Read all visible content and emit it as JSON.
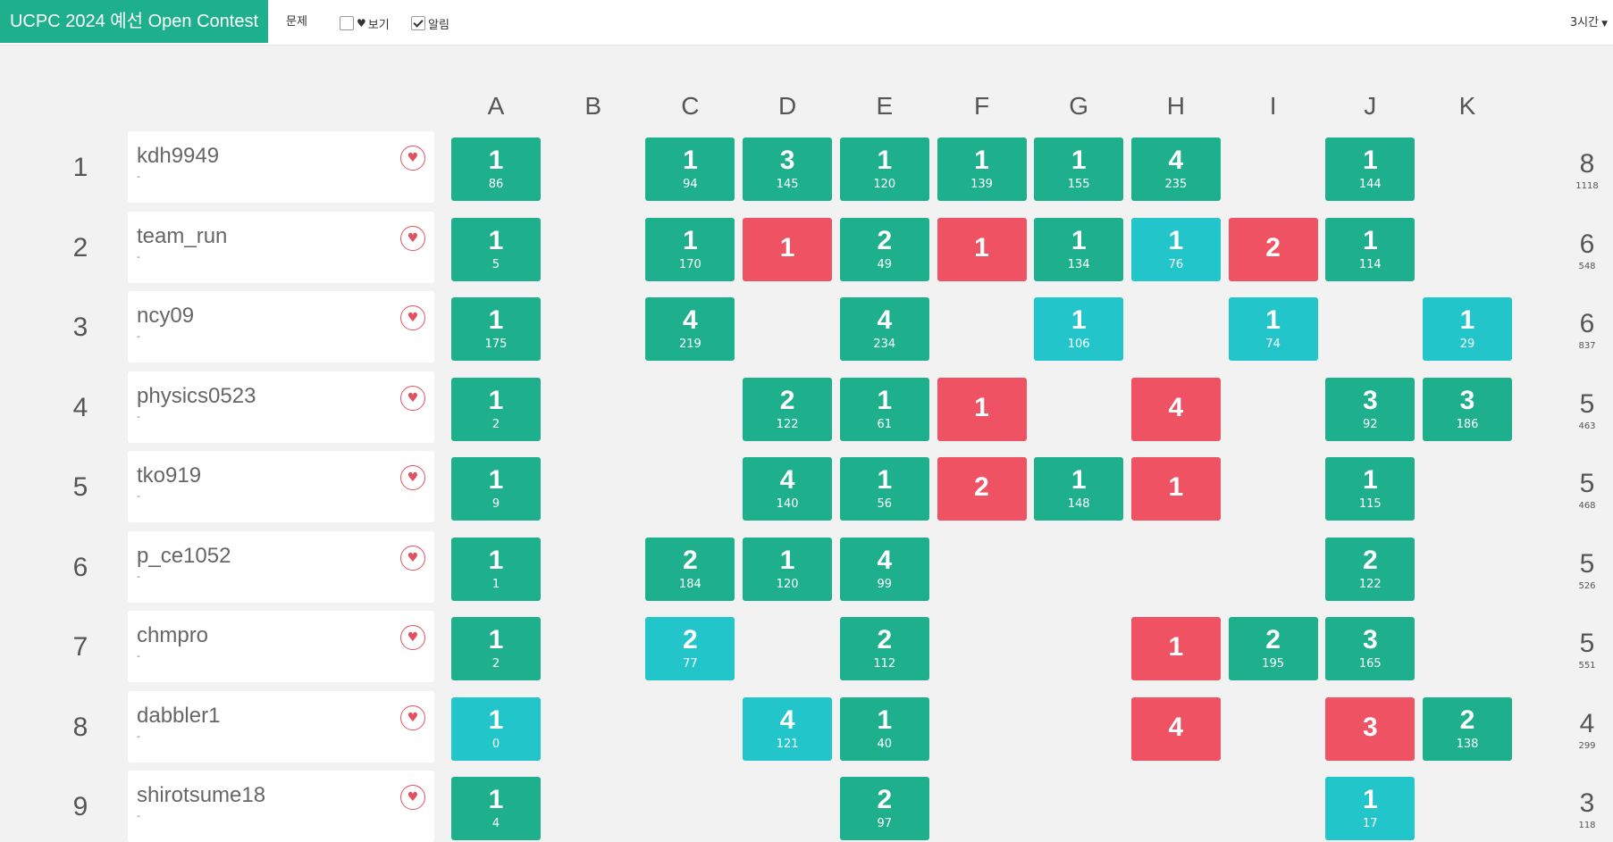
{
  "header": {
    "contest_title": "UCPC 2024 예선 Open Contest",
    "problem_menu": "문제",
    "view_label": "보기",
    "view_checked": false,
    "notify_label": "알림",
    "notify_checked": true,
    "time_select": "3시간"
  },
  "columns": [
    "A",
    "B",
    "C",
    "D",
    "E",
    "F",
    "G",
    "H",
    "I",
    "J",
    "K"
  ],
  "colors": {
    "solved": "#1eb08c",
    "first_solve": "#22c5c9",
    "failed": "#ee5263",
    "brand": "#1eb08c"
  },
  "rows": [
    {
      "rank": "1",
      "name": "kdh9949",
      "sub": "-",
      "solved": "8",
      "penalty": "1118",
      "cells": {
        "A": {
          "s": "solved",
          "t": "1",
          "p": "86"
        },
        "C": {
          "s": "solved",
          "t": "1",
          "p": "94"
        },
        "D": {
          "s": "solved",
          "t": "3",
          "p": "145"
        },
        "E": {
          "s": "solved",
          "t": "1",
          "p": "120"
        },
        "F": {
          "s": "solved",
          "t": "1",
          "p": "139"
        },
        "G": {
          "s": "solved",
          "t": "1",
          "p": "155"
        },
        "H": {
          "s": "solved",
          "t": "4",
          "p": "235"
        },
        "J": {
          "s": "solved",
          "t": "1",
          "p": "144"
        }
      }
    },
    {
      "rank": "2",
      "name": "team_run",
      "sub": "-",
      "solved": "6",
      "penalty": "548",
      "cells": {
        "A": {
          "s": "solved",
          "t": "1",
          "p": "5"
        },
        "C": {
          "s": "solved",
          "t": "1",
          "p": "170"
        },
        "D": {
          "s": "fail",
          "t": "1",
          "p": ""
        },
        "E": {
          "s": "solved",
          "t": "2",
          "p": "49"
        },
        "F": {
          "s": "fail",
          "t": "1",
          "p": ""
        },
        "G": {
          "s": "solved",
          "t": "1",
          "p": "134"
        },
        "H": {
          "s": "first",
          "t": "1",
          "p": "76"
        },
        "I": {
          "s": "fail",
          "t": "2",
          "p": ""
        },
        "J": {
          "s": "solved",
          "t": "1",
          "p": "114"
        }
      }
    },
    {
      "rank": "3",
      "name": "ncy09",
      "sub": "-",
      "solved": "6",
      "penalty": "837",
      "cells": {
        "A": {
          "s": "solved",
          "t": "1",
          "p": "175"
        },
        "C": {
          "s": "solved",
          "t": "4",
          "p": "219"
        },
        "E": {
          "s": "solved",
          "t": "4",
          "p": "234"
        },
        "G": {
          "s": "first",
          "t": "1",
          "p": "106"
        },
        "I": {
          "s": "first",
          "t": "1",
          "p": "74"
        },
        "K": {
          "s": "first",
          "t": "1",
          "p": "29"
        }
      }
    },
    {
      "rank": "4",
      "name": "physics0523",
      "sub": "-",
      "solved": "5",
      "penalty": "463",
      "cells": {
        "A": {
          "s": "solved",
          "t": "1",
          "p": "2"
        },
        "D": {
          "s": "solved",
          "t": "2",
          "p": "122"
        },
        "E": {
          "s": "solved",
          "t": "1",
          "p": "61"
        },
        "F": {
          "s": "fail",
          "t": "1",
          "p": ""
        },
        "H": {
          "s": "fail",
          "t": "4",
          "p": ""
        },
        "J": {
          "s": "solved",
          "t": "3",
          "p": "92"
        },
        "K": {
          "s": "solved",
          "t": "3",
          "p": "186"
        }
      }
    },
    {
      "rank": "5",
      "name": "tko919",
      "sub": "-",
      "solved": "5",
      "penalty": "468",
      "cells": {
        "A": {
          "s": "solved",
          "t": "1",
          "p": "9"
        },
        "D": {
          "s": "solved",
          "t": "4",
          "p": "140"
        },
        "E": {
          "s": "solved",
          "t": "1",
          "p": "56"
        },
        "F": {
          "s": "fail",
          "t": "2",
          "p": ""
        },
        "G": {
          "s": "solved",
          "t": "1",
          "p": "148"
        },
        "H": {
          "s": "fail",
          "t": "1",
          "p": ""
        },
        "J": {
          "s": "solved",
          "t": "1",
          "p": "115"
        }
      }
    },
    {
      "rank": "6",
      "name": "p_ce1052",
      "sub": "-",
      "solved": "5",
      "penalty": "526",
      "cells": {
        "A": {
          "s": "solved",
          "t": "1",
          "p": "1"
        },
        "C": {
          "s": "solved",
          "t": "2",
          "p": "184"
        },
        "D": {
          "s": "solved",
          "t": "1",
          "p": "120"
        },
        "E": {
          "s": "solved",
          "t": "4",
          "p": "99"
        },
        "J": {
          "s": "solved",
          "t": "2",
          "p": "122"
        }
      }
    },
    {
      "rank": "7",
      "name": "chmpro",
      "sub": "-",
      "solved": "5",
      "penalty": "551",
      "cells": {
        "A": {
          "s": "solved",
          "t": "1",
          "p": "2"
        },
        "C": {
          "s": "first",
          "t": "2",
          "p": "77"
        },
        "E": {
          "s": "solved",
          "t": "2",
          "p": "112"
        },
        "H": {
          "s": "fail",
          "t": "1",
          "p": ""
        },
        "I": {
          "s": "solved",
          "t": "2",
          "p": "195"
        },
        "J": {
          "s": "solved",
          "t": "3",
          "p": "165"
        }
      }
    },
    {
      "rank": "8",
      "name": "dabbler1",
      "sub": "-",
      "solved": "4",
      "penalty": "299",
      "cells": {
        "A": {
          "s": "first",
          "t": "1",
          "p": "0"
        },
        "D": {
          "s": "first",
          "t": "4",
          "p": "121"
        },
        "E": {
          "s": "solved",
          "t": "1",
          "p": "40"
        },
        "H": {
          "s": "fail",
          "t": "4",
          "p": ""
        },
        "J": {
          "s": "fail",
          "t": "3",
          "p": ""
        },
        "K": {
          "s": "solved",
          "t": "2",
          "p": "138"
        }
      }
    },
    {
      "rank": "9",
      "name": "shirotsume18",
      "sub": "-",
      "solved": "3",
      "penalty": "118",
      "cells": {
        "A": {
          "s": "solved",
          "t": "1",
          "p": "4"
        },
        "E": {
          "s": "solved",
          "t": "2",
          "p": "97"
        },
        "J": {
          "s": "first",
          "t": "1",
          "p": "17"
        }
      }
    }
  ]
}
